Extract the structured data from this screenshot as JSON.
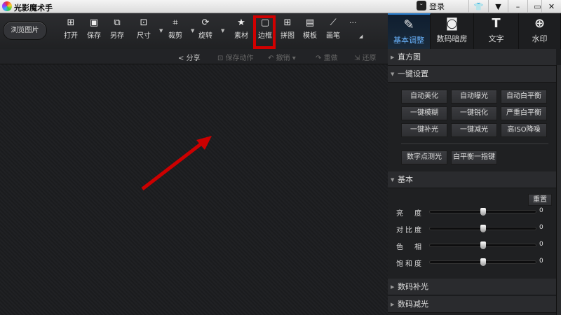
{
  "app": {
    "title": "光影魔术手",
    "login": "登录",
    "window_buttons": [
      "skin",
      "menu",
      "minimize",
      "maximize",
      "close"
    ]
  },
  "toolbar": {
    "browse": "浏览图片",
    "tools": [
      {
        "label": "打开",
        "icon": "open-icon",
        "caret": false
      },
      {
        "label": "保存",
        "icon": "save-icon",
        "caret": false
      },
      {
        "label": "另存",
        "icon": "save-as-icon",
        "caret": false
      },
      {
        "label": "尺寸",
        "icon": "resize-icon",
        "caret": true
      },
      {
        "label": "裁剪",
        "icon": "crop-icon",
        "caret": true
      },
      {
        "label": "旋转",
        "icon": "rotate-icon",
        "caret": true
      },
      {
        "label": "素材",
        "icon": "material-icon",
        "caret": false
      },
      {
        "label": "边框",
        "icon": "border-icon",
        "caret": false
      },
      {
        "label": "拼图",
        "icon": "collage-icon",
        "caret": false
      },
      {
        "label": "模板",
        "icon": "template-icon",
        "caret": false
      },
      {
        "label": "画笔",
        "icon": "brush-icon",
        "caret": false
      }
    ],
    "more": "···"
  },
  "subbar": {
    "share": "分享",
    "save_action": "保存动作",
    "undo": "撤销",
    "redo": "重做",
    "restore": "还原"
  },
  "tabs": [
    "基本调整",
    "数码暗房",
    "文字",
    "水印"
  ],
  "panel": {
    "histogram": "直方图",
    "one_click": {
      "title": "一键设置",
      "buttons": [
        "自动美化",
        "自动曝光",
        "自动白平衡",
        "一键模糊",
        "一键锐化",
        "严重白平衡",
        "一键补光",
        "一键减光",
        "高ISO降噪"
      ],
      "extra": [
        "数字点测光",
        "白平衡一指键"
      ]
    },
    "basic": {
      "title": "基本",
      "reset": "重置",
      "sliders": [
        {
          "label": "亮　度",
          "value": "0",
          "fraction": 0.5
        },
        {
          "label": "对比度",
          "value": "0",
          "fraction": 0.5
        },
        {
          "label": "色　相",
          "value": "0",
          "fraction": 0.5
        },
        {
          "label": "饱和度",
          "value": "0",
          "fraction": 0.5
        }
      ]
    },
    "digital_fill": "数码补光",
    "digital_reduce": "数码减光"
  },
  "colors": {
    "highlight": "#d10000",
    "arrow": "#cc0000",
    "accent": "#2a7fd0"
  }
}
